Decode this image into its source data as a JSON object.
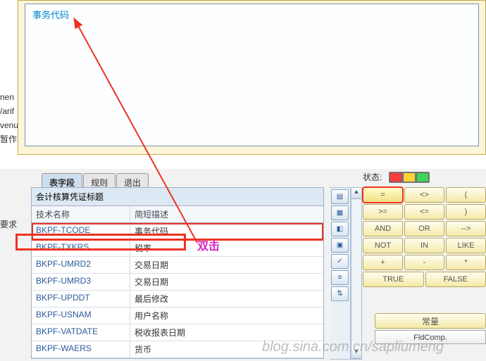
{
  "upper": {
    "field_label": "事务代码"
  },
  "left_labels": [
    "nen",
    "/arif",
    "venu",
    "暂作"
  ],
  "request_label": "要求",
  "tabs": {
    "fields": "表字段",
    "rules": "规则",
    "exit": "退出"
  },
  "panel": {
    "group_header": "会计核算凭证标题",
    "col_tech": "技术名称",
    "col_desc": "简短描述",
    "rows": [
      {
        "tech": "BKPF-TCODE",
        "desc": "事务代码",
        "hl": true
      },
      {
        "tech": "BKPF-TXKRS",
        "desc": "税率"
      },
      {
        "tech": "BKPF-UMRD2",
        "desc": "交易日期"
      },
      {
        "tech": "BKPF-UMRD3",
        "desc": "交易日期"
      },
      {
        "tech": "BKPF-UPDDT",
        "desc": "最后修改"
      },
      {
        "tech": "BKPF-USNAM",
        "desc": "用户名称"
      },
      {
        "tech": "BKPF-VATDATE",
        "desc": "税收报表日期"
      },
      {
        "tech": "BKPF-WAERS",
        "desc": "货币"
      }
    ]
  },
  "toolbar_icons": [
    "▤",
    "▦",
    "◧",
    "▣",
    "✓",
    "≡",
    "⇅"
  ],
  "status": {
    "label": "状态:"
  },
  "ops": [
    [
      {
        "t": "=",
        "sel": true
      },
      {
        "t": "<>"
      },
      {
        "t": "("
      }
    ],
    [
      {
        "t": ">="
      },
      {
        "t": "<="
      },
      {
        "t": ")"
      }
    ],
    [
      {
        "t": "AND"
      },
      {
        "t": "OR"
      },
      {
        "t": "-->"
      }
    ],
    [
      {
        "t": "NOT"
      },
      {
        "t": "IN"
      },
      {
        "t": "LIKE"
      }
    ],
    [
      {
        "t": "+"
      },
      {
        "t": "-"
      },
      {
        "t": "*"
      }
    ],
    [
      {
        "t": "TRUE"
      },
      {
        "t": "FALSE"
      }
    ]
  ],
  "constants": {
    "header": "常量",
    "fldcomp": "FldComp."
  },
  "annotation": {
    "dblclick": "双击"
  },
  "watermark": "blog.sina.com.cn/sapliumeng"
}
